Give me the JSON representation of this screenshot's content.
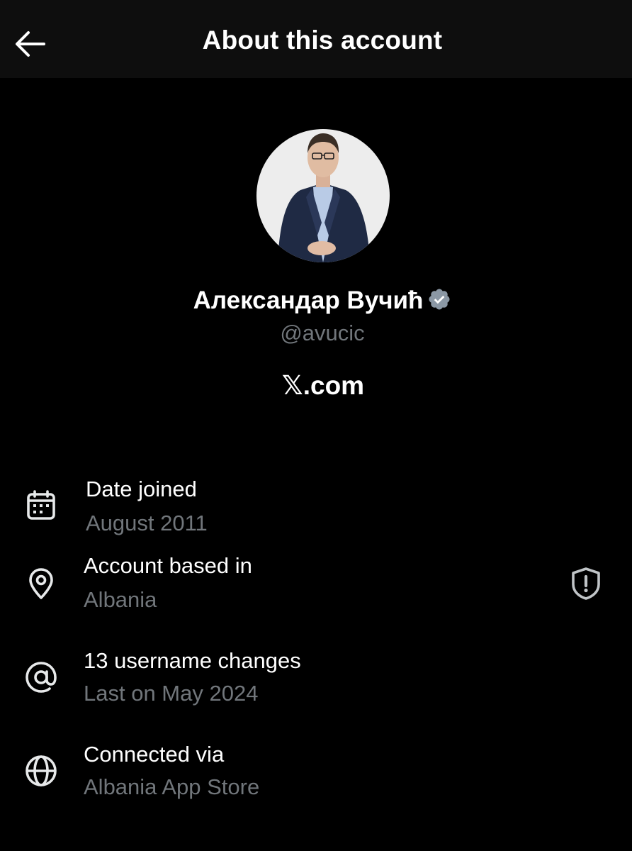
{
  "header": {
    "title": "About this account",
    "back_icon": "arrow-left-icon"
  },
  "profile": {
    "display_name": "Александар Вучић",
    "verified": true,
    "verified_color": "#8b98a5",
    "handle": "@avucic",
    "site": "𝕏.com"
  },
  "details": [
    {
      "icon": "calendar-icon",
      "title": "Date joined",
      "value": "August 2011"
    },
    {
      "icon": "location-pin-icon",
      "title": "Account based in",
      "value": "Albania",
      "trailing_icon": "shield-alert-icon"
    },
    {
      "icon": "at-sign-icon",
      "title": "13 username changes",
      "value": "Last on May 2024"
    },
    {
      "icon": "globe-icon",
      "title": "Connected via",
      "value": "Albania App Store"
    }
  ],
  "colors": {
    "background": "#000000",
    "header_bg": "#0e0e0e",
    "primary_text": "#ffffff",
    "secondary_text": "#71767b"
  }
}
